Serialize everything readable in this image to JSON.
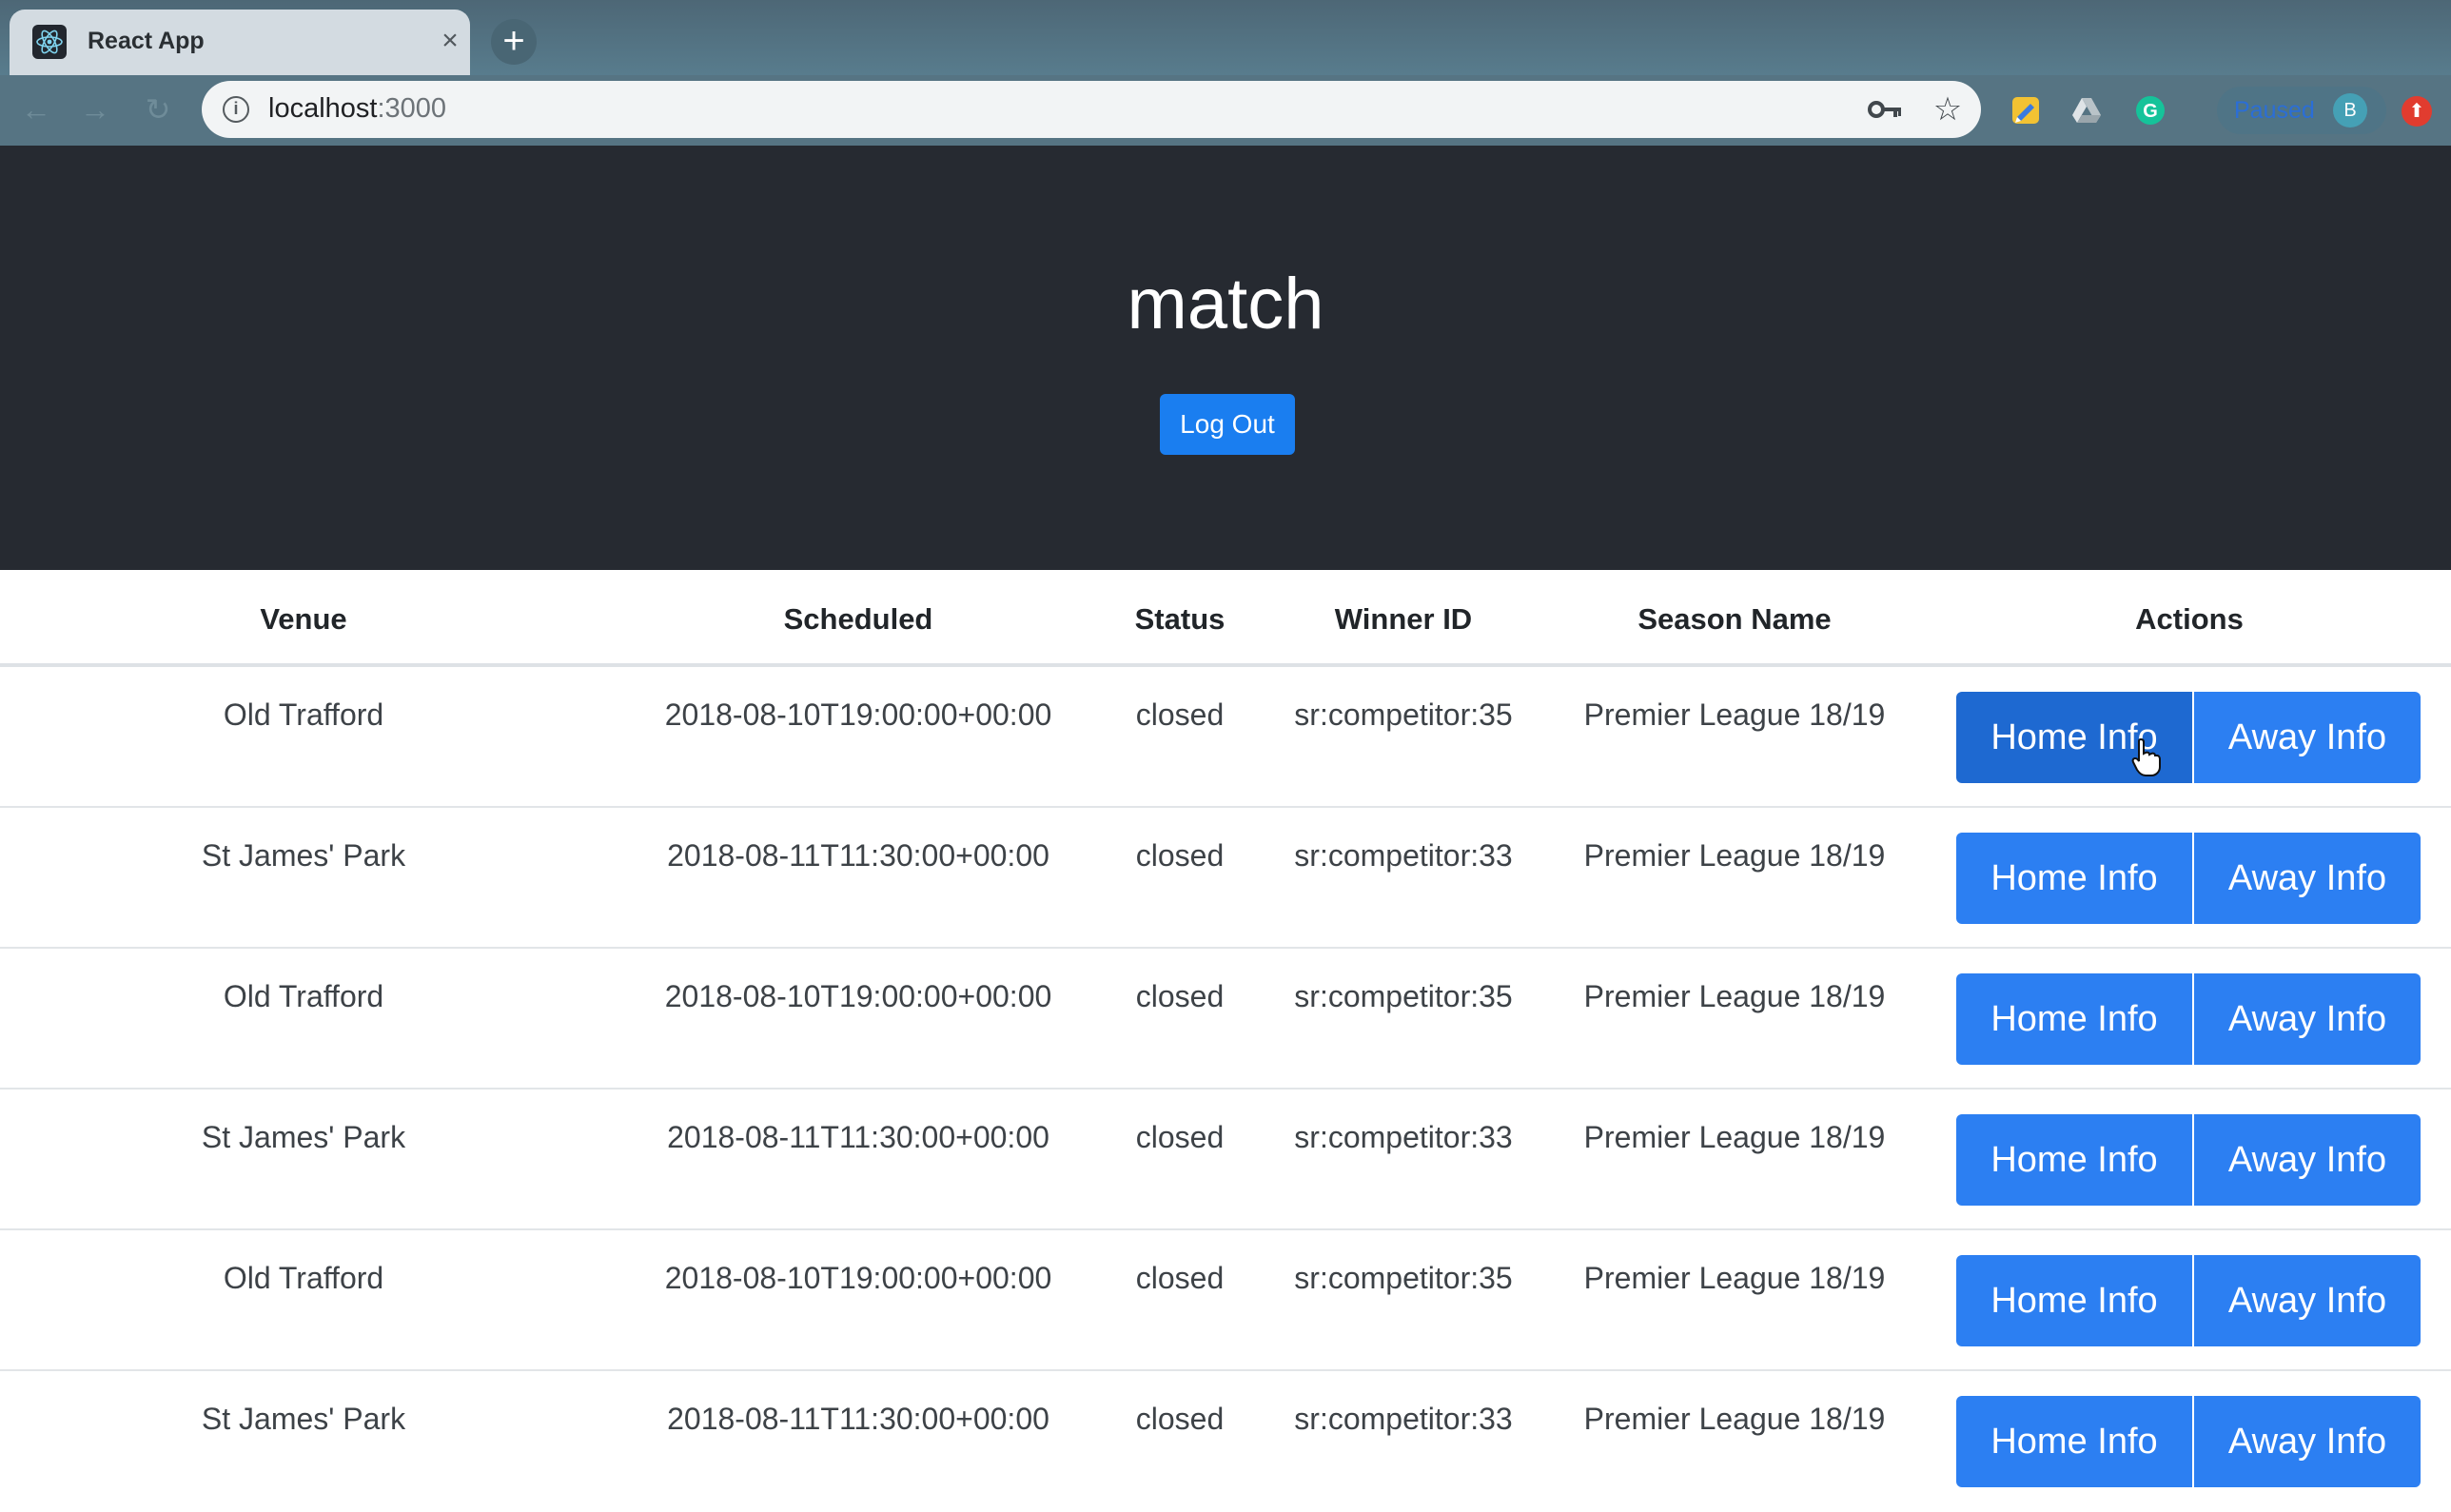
{
  "browser": {
    "tab_title": "React App",
    "tab_close": "×",
    "new_tab": "+",
    "url_host": "localhost",
    "url_port": ":3000",
    "profile_status": "Paused",
    "profile_initial": "B"
  },
  "header": {
    "title": "match",
    "logout_label": "Log Out"
  },
  "table": {
    "columns": [
      "Venue",
      "Scheduled",
      "Status",
      "Winner ID",
      "Season Name",
      "Actions"
    ],
    "home_label": "Home Info",
    "away_label": "Away Info",
    "rows": [
      {
        "venue": "Old Trafford",
        "scheduled": "2018-08-10T19:00:00+00:00",
        "status": "closed",
        "winner_id": "sr:competitor:35",
        "season": "Premier League 18/19"
      },
      {
        "venue": "St James' Park",
        "scheduled": "2018-08-11T11:30:00+00:00",
        "status": "closed",
        "winner_id": "sr:competitor:33",
        "season": "Premier League 18/19"
      },
      {
        "venue": "Old Trafford",
        "scheduled": "2018-08-10T19:00:00+00:00",
        "status": "closed",
        "winner_id": "sr:competitor:35",
        "season": "Premier League 18/19"
      },
      {
        "venue": "St James' Park",
        "scheduled": "2018-08-11T11:30:00+00:00",
        "status": "closed",
        "winner_id": "sr:competitor:33",
        "season": "Premier League 18/19"
      },
      {
        "venue": "Old Trafford",
        "scheduled": "2018-08-10T19:00:00+00:00",
        "status": "closed",
        "winner_id": "sr:competitor:35",
        "season": "Premier League 18/19"
      },
      {
        "venue": "St James' Park",
        "scheduled": "2018-08-11T11:30:00+00:00",
        "status": "closed",
        "winner_id": "sr:competitor:33",
        "season": "Premier League 18/19"
      }
    ]
  },
  "colors": {
    "header_bg": "#262a31",
    "button_primary": "#2c7ff2",
    "button_active": "#1e69d1"
  }
}
